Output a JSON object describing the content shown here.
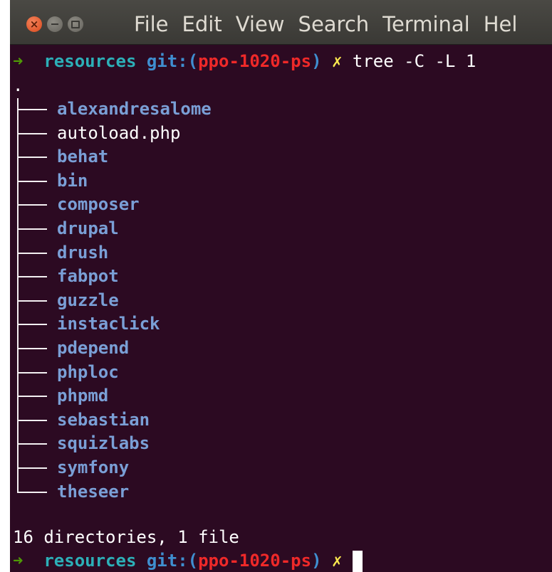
{
  "window": {
    "menu": [
      "File",
      "Edit",
      "View",
      "Search",
      "Terminal",
      "Hel"
    ]
  },
  "prompt": {
    "arrow": "➜",
    "cwd": "resources",
    "git_label": "git:(",
    "branch": "ppo-1020-ps",
    "git_close": ")",
    "dirty_mark": "✗"
  },
  "command": "tree -C -L 1",
  "tree_root": ".",
  "entries": [
    {
      "name": "alexandresalome",
      "type": "dir"
    },
    {
      "name": "autoload.php",
      "type": "file"
    },
    {
      "name": "behat",
      "type": "dir"
    },
    {
      "name": "bin",
      "type": "dir"
    },
    {
      "name": "composer",
      "type": "dir"
    },
    {
      "name": "drupal",
      "type": "dir"
    },
    {
      "name": "drush",
      "type": "dir"
    },
    {
      "name": "fabpot",
      "type": "dir"
    },
    {
      "name": "guzzle",
      "type": "dir"
    },
    {
      "name": "instaclick",
      "type": "dir"
    },
    {
      "name": "pdepend",
      "type": "dir"
    },
    {
      "name": "phploc",
      "type": "dir"
    },
    {
      "name": "phpmd",
      "type": "dir"
    },
    {
      "name": "sebastian",
      "type": "dir"
    },
    {
      "name": "squizlabs",
      "type": "dir"
    },
    {
      "name": "symfony",
      "type": "dir"
    },
    {
      "name": "theseer",
      "type": "dir"
    }
  ],
  "summary": "16 directories, 1 file",
  "colors": {
    "background": "#2c0a22",
    "directory": "#7a9fd6",
    "branch": "#ef2929",
    "arrow": "#4e9a06"
  }
}
